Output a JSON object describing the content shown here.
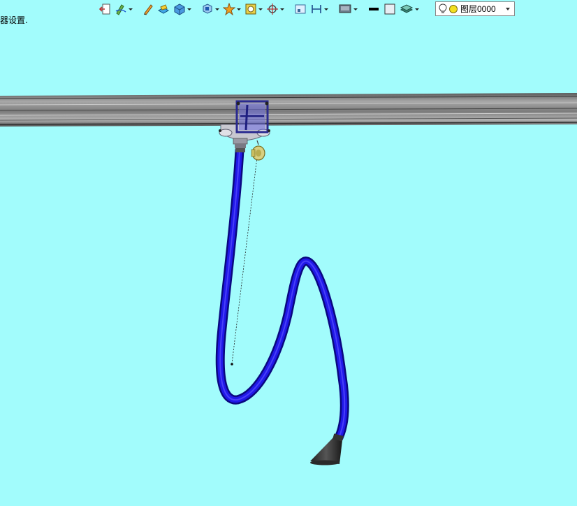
{
  "status_message": "器设置.",
  "layer_selector": {
    "value": "图层0000"
  },
  "colors": {
    "viewport_background": "#a2fcfc",
    "hose": "#1a10d0",
    "rail": "#8a8a8a",
    "trolley_frame": "#3a3ab0"
  },
  "toolbar_icons": [
    "exit-icon",
    "sketcher-icon",
    "pencil-icon",
    "face-icon",
    "box-icon",
    "view-box-icon",
    "star-shape-icon",
    "render-mode-icon",
    "snap-icon",
    "plane-icon",
    "measure-icon",
    "screen-icon",
    "line-color-icon",
    "fill-color-icon",
    "layer-stack-icon"
  ],
  "scene_objects": [
    "overhead-rail",
    "trolley-carriage",
    "pulley-wheel",
    "blue-hose",
    "dotted-cable",
    "nozzle-cone"
  ]
}
